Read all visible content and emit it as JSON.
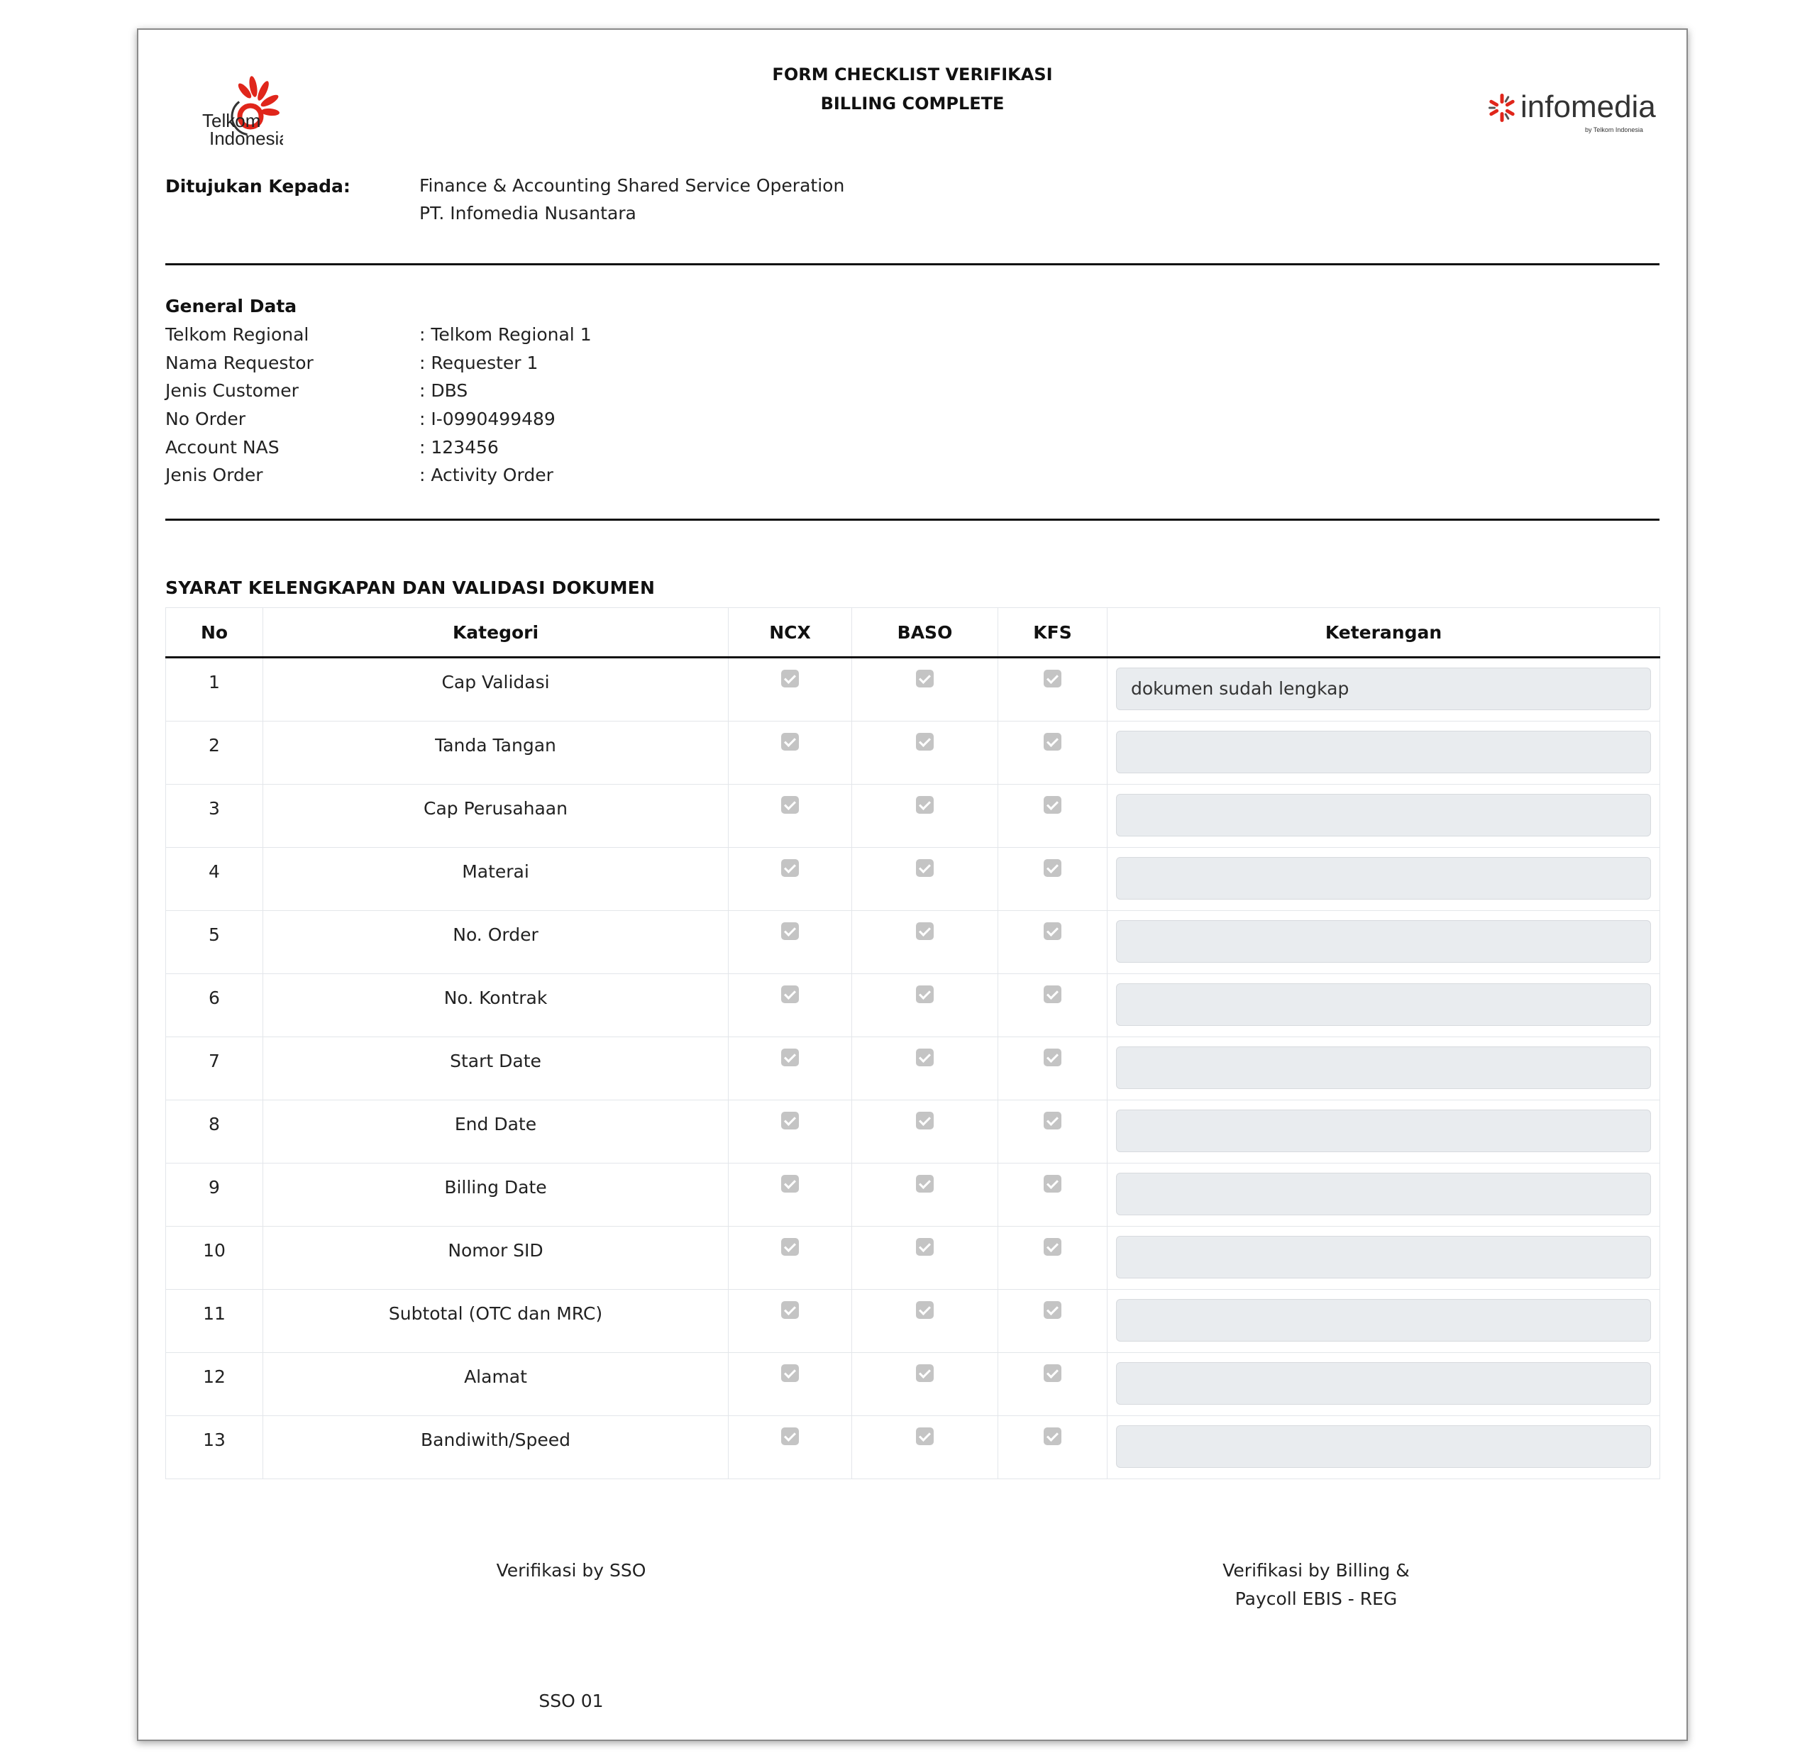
{
  "header": {
    "title_line1": "FORM CHECKLIST VERIFIKASI",
    "title_line2": "BILLING COMPLETE",
    "left_logo_text": [
      "Telkom",
      "Indonesia"
    ],
    "right_logo_text": "infomedia",
    "right_logo_subtext": "by Telkom Indonesia"
  },
  "recipient": {
    "label": "Ditujukan Kepada:",
    "line1": "Finance & Accounting Shared Service Operation",
    "line2": "PT. Infomedia Nusantara"
  },
  "general": {
    "title": "General Data",
    "rows": [
      {
        "key": "Telkom Regional",
        "value": ": Telkom Regional 1"
      },
      {
        "key": "Nama Requestor",
        "value": ": Requester 1"
      },
      {
        "key": "Jenis Customer",
        "value": ": DBS"
      },
      {
        "key": "No Order",
        "value": ": I-0990499489"
      },
      {
        "key": "Account NAS",
        "value": ": 123456"
      },
      {
        "key": "Jenis Order",
        "value": ": Activity Order"
      }
    ]
  },
  "checklist": {
    "section_title": "SYARAT KELENGKAPAN DAN VALIDASI DOKUMEN",
    "columns": [
      "No",
      "Kategori",
      "NCX",
      "BASO",
      "KFS",
      "Keterangan"
    ],
    "rows": [
      {
        "no": "1",
        "kategori": "Cap Validasi",
        "ncx": true,
        "baso": true,
        "kfs": true,
        "keterangan": "dokumen sudah lengkap"
      },
      {
        "no": "2",
        "kategori": "Tanda Tangan",
        "ncx": true,
        "baso": true,
        "kfs": true,
        "keterangan": ""
      },
      {
        "no": "3",
        "kategori": "Cap Perusahaan",
        "ncx": true,
        "baso": true,
        "kfs": true,
        "keterangan": ""
      },
      {
        "no": "4",
        "kategori": "Materai",
        "ncx": true,
        "baso": true,
        "kfs": true,
        "keterangan": ""
      },
      {
        "no": "5",
        "kategori": "No. Order",
        "ncx": true,
        "baso": true,
        "kfs": true,
        "keterangan": ""
      },
      {
        "no": "6",
        "kategori": "No. Kontrak",
        "ncx": true,
        "baso": true,
        "kfs": true,
        "keterangan": ""
      },
      {
        "no": "7",
        "kategori": "Start Date",
        "ncx": true,
        "baso": true,
        "kfs": true,
        "keterangan": ""
      },
      {
        "no": "8",
        "kategori": "End Date",
        "ncx": true,
        "baso": true,
        "kfs": true,
        "keterangan": ""
      },
      {
        "no": "9",
        "kategori": "Billing Date",
        "ncx": true,
        "baso": true,
        "kfs": true,
        "keterangan": ""
      },
      {
        "no": "10",
        "kategori": "Nomor SID",
        "ncx": true,
        "baso": true,
        "kfs": true,
        "keterangan": ""
      },
      {
        "no": "11",
        "kategori": "Subtotal (OTC dan MRC)",
        "ncx": true,
        "baso": true,
        "kfs": true,
        "keterangan": ""
      },
      {
        "no": "12",
        "kategori": "Alamat",
        "ncx": true,
        "baso": true,
        "kfs": true,
        "keterangan": ""
      },
      {
        "no": "13",
        "kategori": "Bandiwith/Speed",
        "ncx": true,
        "baso": true,
        "kfs": true,
        "keterangan": ""
      }
    ]
  },
  "signatures": {
    "sso_label": "Verifikasi by SSO",
    "billing_label_line1": "Verifikasi by Billing &",
    "billing_label_line2": "Paycoll EBIS - REG",
    "sso_name": "SSO 01"
  },
  "colors": {
    "telkom_red": "#e0261b",
    "checkbox_disabled": "#c4c4c4",
    "input_readonly_bg": "#e9ecef"
  }
}
